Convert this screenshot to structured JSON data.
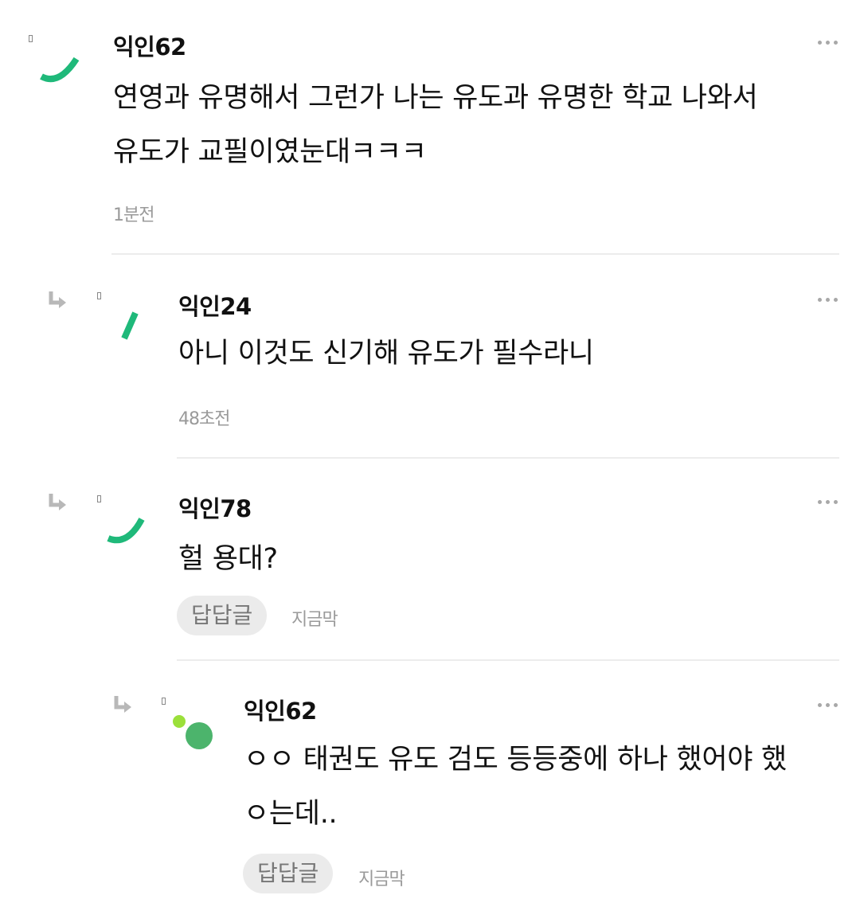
{
  "colors": {
    "accent": "#1fb97a",
    "accent_light": "#9be03a",
    "meta": "#9a9a9a"
  },
  "comments": [
    {
      "nickname": "익인62",
      "lines": [
        "연영과 유명해서 그런가 나는 유도과 유명한 학교 나와서",
        "유도가 교필이였눈대ㅋㅋㅋ"
      ],
      "time": "1분전",
      "avatar_icon": "arc-avatar-icon",
      "more_icon": "more-dots-icon"
    },
    {
      "nickname": "익인24",
      "lines": [
        "아니 이것도 신기해 유도가 필수라니"
      ],
      "time": "48초전",
      "avatar_icon": "slash-avatar-icon",
      "reply_icon": "reply-arrow-icon"
    },
    {
      "nickname": "익인78",
      "lines": [
        "헐 용대?"
      ],
      "reply_button": "답답글",
      "time": "지금막",
      "avatar_icon": "arc-avatar-icon",
      "reply_icon": "reply-arrow-icon"
    },
    {
      "nickname": "익인62",
      "lines": [
        "ㅇㅇ 태권도 유도 검도 등등중에 하나 했어야 했",
        "ㅇ는데.."
      ],
      "reply_button": "답답글",
      "time": "지금막",
      "avatar_icon": "dots-avatar-icon",
      "reply_icon": "reply-arrow-icon"
    }
  ]
}
